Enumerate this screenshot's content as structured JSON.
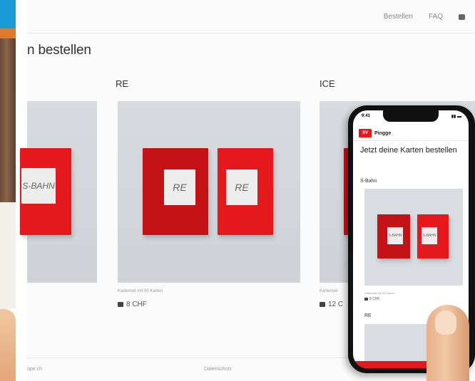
{
  "nav": {
    "items": [
      "Bestellen",
      "FAQ"
    ],
    "cart_icon": "cart-icon"
  },
  "page_title": "n bestellen",
  "products": [
    {
      "label": "",
      "box_text": "S-BAHN",
      "caption": "",
      "price": ""
    },
    {
      "label": "RE",
      "box_text": "RE",
      "caption": "Kartenset mit 50 Karten",
      "price": "8 CHF"
    },
    {
      "label": "ICE",
      "box_text": "",
      "caption": "Kartenset",
      "price": "12 C"
    }
  ],
  "footer": {
    "left": "ope.ch",
    "center": "Datenschutz"
  },
  "phone": {
    "logo": "SV",
    "brand": "Pingge",
    "title": "Jetzt deine Karten bestellen",
    "category": "S-Bahn",
    "box_text": "S-BAHN",
    "caption": "Kartenset mit 50 Karten",
    "price": "8 CHF",
    "category2": "RE"
  },
  "colors": {
    "brand_red": "#e4181d",
    "accent_blue": "#1a9ad6"
  }
}
